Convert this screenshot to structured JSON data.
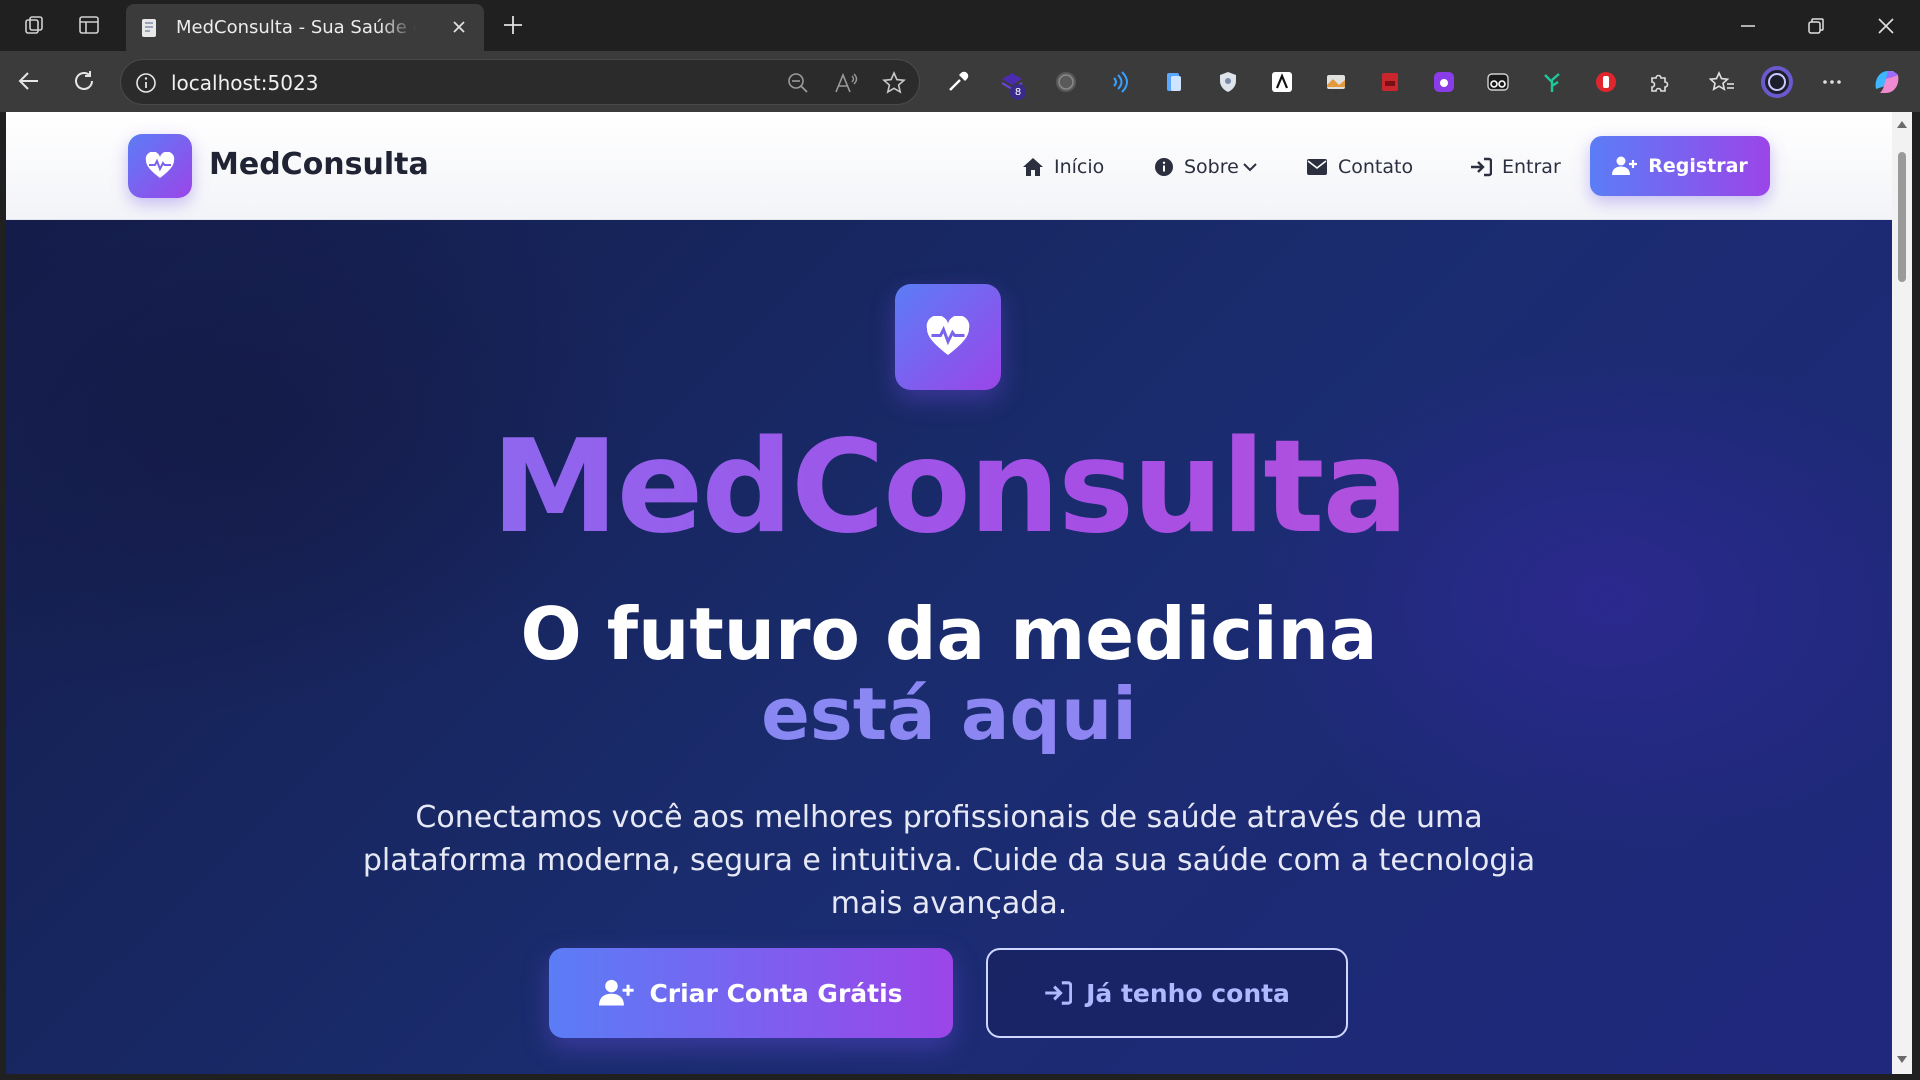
{
  "browser": {
    "tab_title": "MedConsulta - Sua Saúde em Primeiro Lugar",
    "url": "localhost:5023",
    "extension_badge": "8"
  },
  "site": {
    "brand": "MedConsulta",
    "nav": {
      "home": "Início",
      "about": "Sobre",
      "contact": "Contato",
      "login": "Entrar",
      "register": "Registrar"
    }
  },
  "hero": {
    "title": "MedConsulta",
    "subtitle_line1": "O futuro da medicina",
    "subtitle_line2": "está aqui",
    "description": "Conectamos você aos melhores profissionais de saúde através de uma plataforma moderna, segura e intuitiva. Cuide da sua saúde com a tecnologia mais avançada.",
    "cta_primary": "Criar Conta Grátis",
    "cta_secondary": "Já tenho conta"
  },
  "colors": {
    "accent_start": "#5b7df6",
    "accent_end": "#9b45e8",
    "hero_bg": "#1a2c6e",
    "header_bg": "#ffffff"
  }
}
